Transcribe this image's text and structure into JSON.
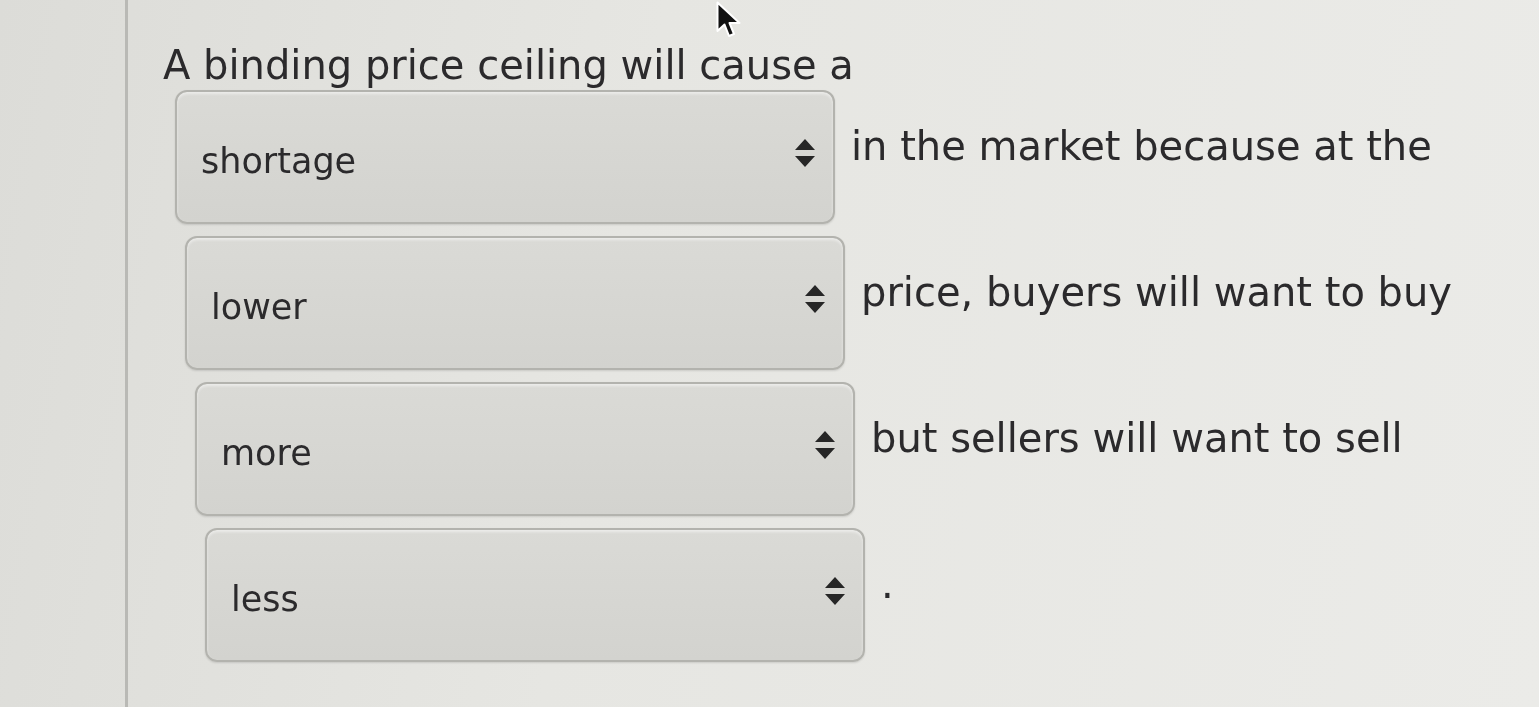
{
  "question": {
    "prompt": "A binding price ceiling will cause a",
    "blanks": [
      {
        "value": "shortage",
        "text_after": "in the market because at the"
      },
      {
        "value": "lower",
        "text_after": "price, buyers will want to buy"
      },
      {
        "value": "more",
        "text_after": "but sellers will want to sell"
      },
      {
        "value": "less",
        "text_after": "."
      }
    ]
  }
}
